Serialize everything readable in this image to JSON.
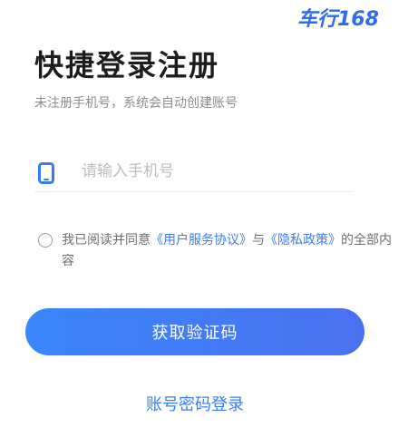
{
  "brand": {
    "logo_text": "车行168",
    "accent_color": "#2f6bea"
  },
  "header": {
    "title": "快捷登录注册",
    "subtitle": "未注册手机号，系统会自动创建账号"
  },
  "phone_field": {
    "icon": "phone-icon",
    "value": "",
    "placeholder": "请输入手机号"
  },
  "agreement": {
    "checked": false,
    "prefix": "我已阅读并同意",
    "user_agreement": "《用户服务协议》",
    "conjunction": "与",
    "privacy_policy": "《隐私政策》",
    "suffix": "的全部内容"
  },
  "primary_button": {
    "label": "获取验证码",
    "color": "#3a86fb"
  },
  "alt_login": {
    "label": "账号密码登录",
    "color": "#3b7cf5"
  }
}
